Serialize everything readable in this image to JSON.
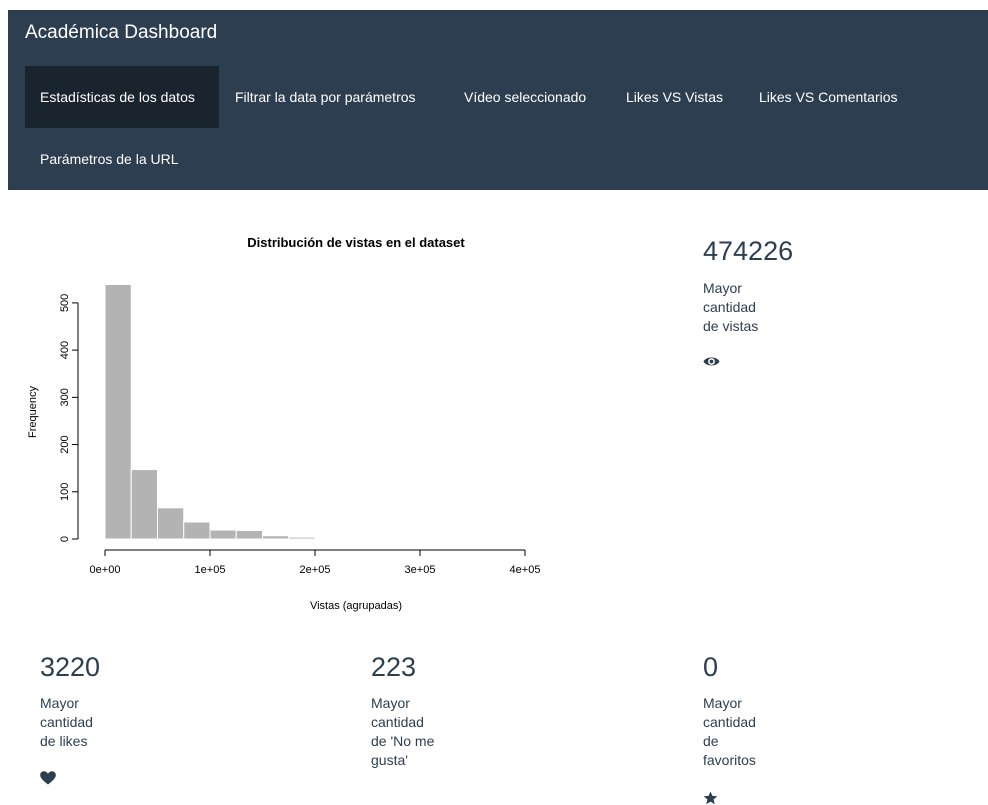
{
  "app": {
    "title": "Académica Dashboard"
  },
  "nav": {
    "tabs": [
      {
        "label": "Estadísticas de los datos",
        "active": true
      },
      {
        "label": "Filtrar la data por parámetros",
        "active": false
      },
      {
        "label": "Vídeo seleccionado",
        "active": false
      },
      {
        "label": "Likes VS Vistas",
        "active": false
      },
      {
        "label": "Likes VS Comentarios",
        "active": false
      },
      {
        "label": "Parámetros de la URL",
        "active": false
      }
    ]
  },
  "stats": {
    "views": {
      "value": "474226",
      "label": [
        "Mayor",
        "cantidad",
        "de vistas"
      ],
      "icon": "eye-icon"
    },
    "likes": {
      "value": "3220",
      "label": [
        "Mayor",
        "cantidad",
        "de likes"
      ],
      "icon": "heart-icon"
    },
    "dislikes": {
      "value": "223",
      "label": [
        "Mayor",
        "cantidad",
        "de 'No me",
        "gusta'"
      ]
    },
    "favorites": {
      "value": "0",
      "label": [
        "Mayor",
        "cantidad",
        "de",
        "favoritos"
      ],
      "icon": "star-icon"
    }
  },
  "colors": {
    "navbar": "#2c3e50",
    "active_tab": "#1a242f",
    "text": "#2c3e50",
    "bars": "#b3b3b3"
  },
  "chart_data": {
    "type": "bar",
    "title": "Distribución de vistas en el dataset",
    "xlabel": "Vistas (agrupadas)",
    "ylabel": "Frequency",
    "bin_edges": [
      0,
      25000,
      50000,
      75000,
      100000,
      125000,
      150000,
      175000,
      200000,
      225000,
      250000,
      275000,
      300000,
      325000,
      350000
    ],
    "values": [
      539,
      147,
      66,
      36,
      19,
      18,
      7,
      4,
      2,
      0,
      1,
      1,
      2,
      2
    ],
    "xlim": [
      0,
      400000
    ],
    "ylim": [
      0,
      540
    ],
    "xticks": [
      0,
      100000,
      200000,
      300000,
      400000
    ],
    "xtick_labels": [
      "0e+00",
      "1e+05",
      "2e+05",
      "3e+05",
      "4e+05"
    ],
    "yticks": [
      0,
      100,
      200,
      300,
      400,
      500
    ],
    "ytick_labels": [
      "0",
      "100",
      "200",
      "300",
      "400",
      "500"
    ],
    "grid": false
  }
}
